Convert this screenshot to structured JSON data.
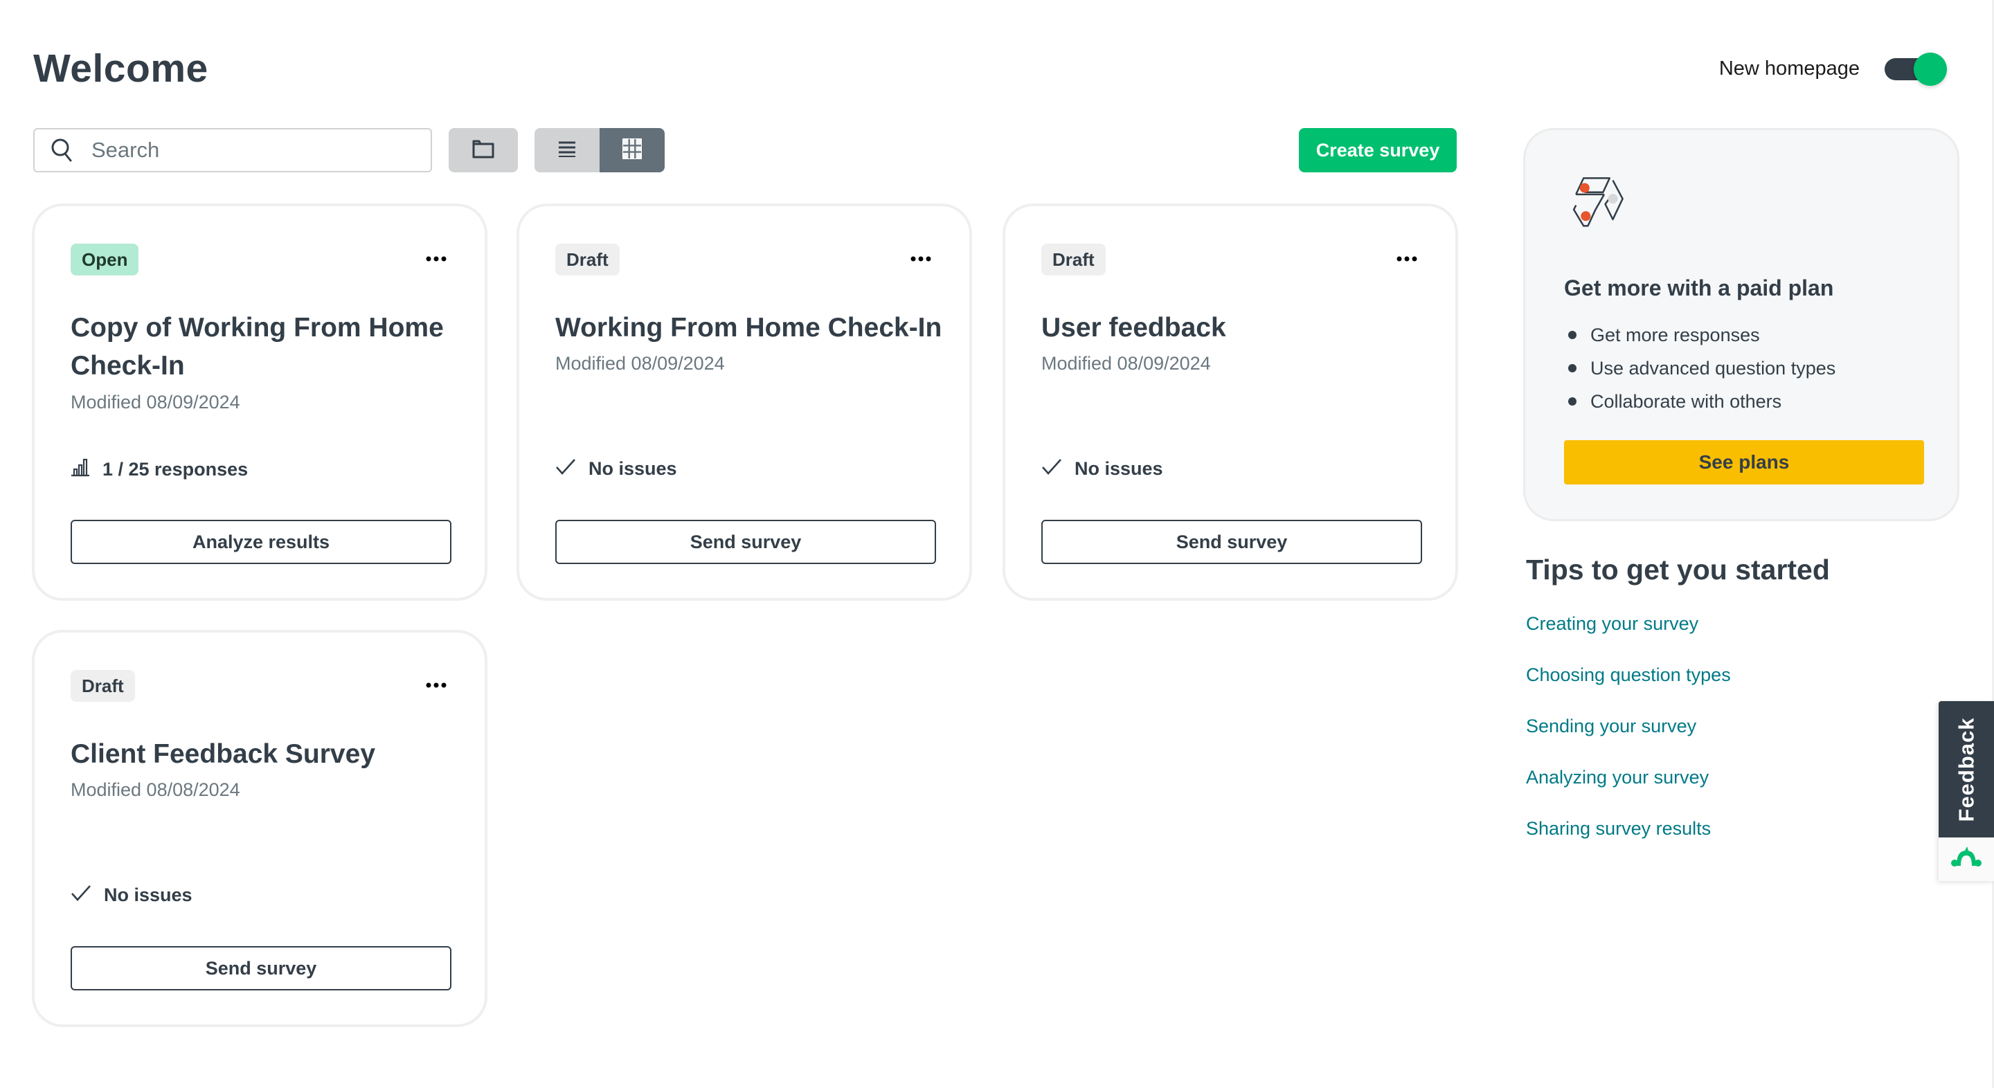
{
  "page": {
    "title": "Welcome",
    "homepage_toggle": {
      "label": "New homepage",
      "on": true
    }
  },
  "toolbar": {
    "search_placeholder": "Search",
    "search_value": "",
    "folder_icon": "folder-icon",
    "view_list_icon": "list-view-icon",
    "view_grid_icon": "grid-view-icon",
    "active_view": "grid",
    "create_label": "Create survey"
  },
  "colors": {
    "brand_green": "#00bf6f",
    "text_dark": "#333e48",
    "link_teal": "#007a86",
    "cta_yellow": "#f9be00",
    "open_badge": "#b2ebd3",
    "draft_badge": "#efefef"
  },
  "surveys": [
    {
      "status": "Open",
      "title": "Copy of Working From Home Check-In",
      "modified": "Modified 08/09/2024",
      "info_icon": "bar-chart-icon",
      "info": "1 / 25 responses",
      "action": "Analyze results"
    },
    {
      "status": "Draft",
      "title": "Working From Home Check-In",
      "modified": "Modified 08/09/2024",
      "info_icon": "checkmark-icon",
      "info": "No issues",
      "action": "Send survey"
    },
    {
      "status": "Draft",
      "title": "User feedback",
      "modified": "Modified 08/09/2024",
      "info_icon": "checkmark-icon",
      "info": "No issues",
      "action": "Send survey"
    },
    {
      "status": "Draft",
      "title": "Client Feedback Survey",
      "modified": "Modified 08/08/2024",
      "info_icon": "checkmark-icon",
      "info": "No issues",
      "action": "Send survey"
    }
  ],
  "upsell": {
    "heading": "Get more with a paid plan",
    "bullets": [
      "Get more responses",
      "Use advanced question types",
      "Collaborate with others"
    ],
    "cta": "See plans"
  },
  "tips": {
    "heading": "Tips to get you started",
    "links": [
      "Creating your survey",
      "Choosing question types",
      "Sending your survey",
      "Analyzing your survey",
      "Sharing survey results"
    ]
  },
  "feedback_tab": {
    "label": "Feedback",
    "icon": "surveymonkey-logo-icon"
  }
}
